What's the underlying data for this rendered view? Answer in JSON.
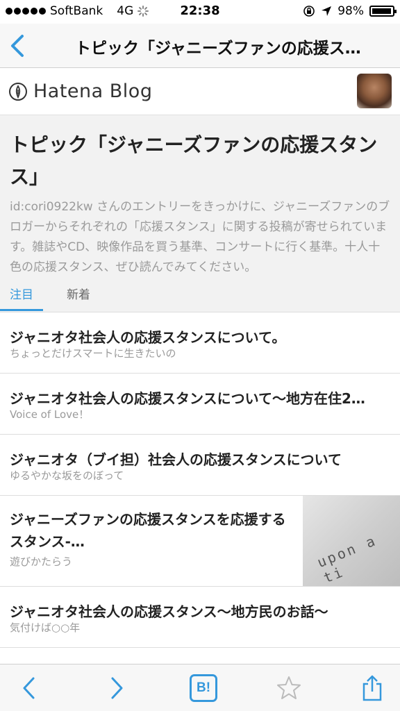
{
  "status_bar": {
    "carrier": "SoftBank",
    "network": "4G",
    "time": "22:38",
    "battery": "98%",
    "battery_level": 0.98,
    "icons": [
      "signal-dots",
      "activity-spinner-icon",
      "rotation-lock-icon",
      "location-arrow-icon",
      "battery-icon"
    ]
  },
  "nav": {
    "back_icon": "chevron-left-icon",
    "title": "トピック「ジャニーズファンの応援ス…"
  },
  "brand": {
    "logo_icon": "hatena-pen-icon",
    "name": "Hatena Blog",
    "avatar": "user-avatar"
  },
  "topic": {
    "title": "トピック「ジャニーズファンの応援スタンス」",
    "description": "id:cori0922kw さんのエントリーをきっかけに、ジャニーズファンのブロガーからそれぞれの「応援スタンス」に関する投稿が寄せられています。雑誌やCD、映像作品を買う基準、コンサートに行く基準。十人十色の応援スタンス、ぜひ読んでみてください。",
    "tabs": [
      {
        "label": "注目",
        "active": true
      },
      {
        "label": "新着",
        "active": false
      }
    ]
  },
  "entries": [
    {
      "title": "ジャニオタ社会人の応援スタンスについて。",
      "blog": "ちょっとだけスマートに生きたいの"
    },
    {
      "title": "ジャニオタ社会人の応援スタンスについて〜地方在住2…",
      "blog": "Voice of Love！"
    },
    {
      "title": "ジャニオタ（ブイ担）社会人の応援スタンスについて",
      "blog": "ゆるやかな坂をのぼって"
    },
    {
      "title": "ジャニーズファンの応援スタンスを応援するスタンス-…",
      "blog": "遊びかたらう",
      "thumb_text": "upon a ti"
    },
    {
      "title": "ジャニオタ社会人の応援スタンス〜地方民のお話〜",
      "blog": "気付けば○○年"
    }
  ],
  "toolbar": {
    "back_icon": "chevron-left-icon",
    "forward_icon": "chevron-right-icon",
    "hatena_bookmark_label": "B!",
    "star_icon": "star-outline-icon",
    "share_icon": "share-icon"
  },
  "colors": {
    "accent": "#3598dc",
    "muted_text": "#9a9a9a",
    "header_bg": "#f2f2f2"
  }
}
